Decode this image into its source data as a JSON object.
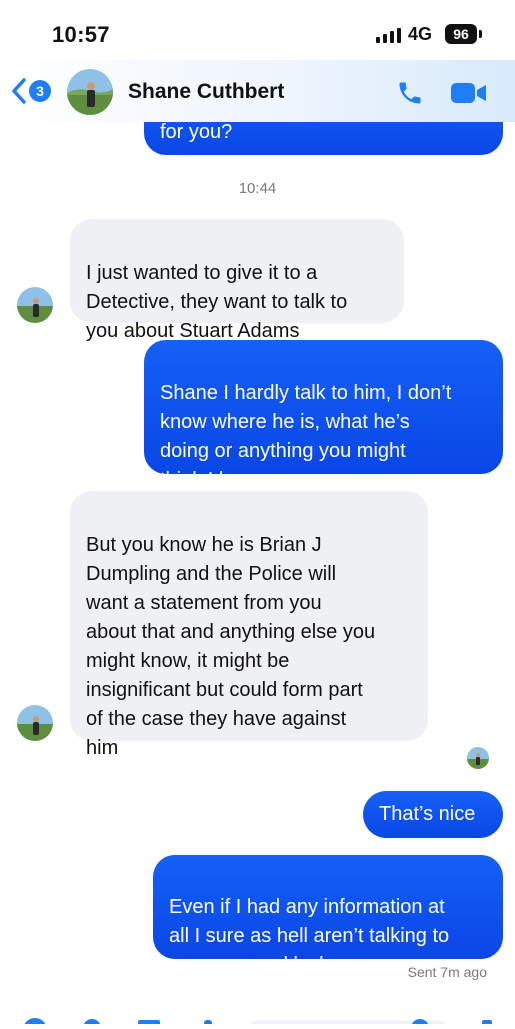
{
  "status_bar": {
    "time": "10:57",
    "network": "4G",
    "battery": "96"
  },
  "header": {
    "back_count": "3",
    "contact_name": "Shane Cuthbert"
  },
  "messages": {
    "m0": "for you?",
    "timestamp": "10:44",
    "m1": "I just wanted to give it to a\nDetective, they want to talk to\nyou about Stuart Adams",
    "m2": "Shane I hardly talk to him, I don’t\nknow where he is, what he’s\ndoing or anything you might\nthink I know.",
    "m3": "But you know he is Brian J\nDumpling and the Police will\nwant a statement from you\nabout that and anything else you\nmight know, it might be\ninsignificant but could form part\nof the case they have against\nhim",
    "m4": "That’s nice",
    "m5": "Even if I had any information at\nall I sure as hell aren’t talking to\ncops so good luck"
  },
  "footer": {
    "sent_status": "Sent 7m ago"
  },
  "colors": {
    "outgoing": "#0a5df5",
    "incoming": "#eff0f4",
    "accent": "#1f7df5"
  },
  "icons": [
    "chevron-left-icon",
    "phone-icon",
    "video-camera-icon"
  ]
}
